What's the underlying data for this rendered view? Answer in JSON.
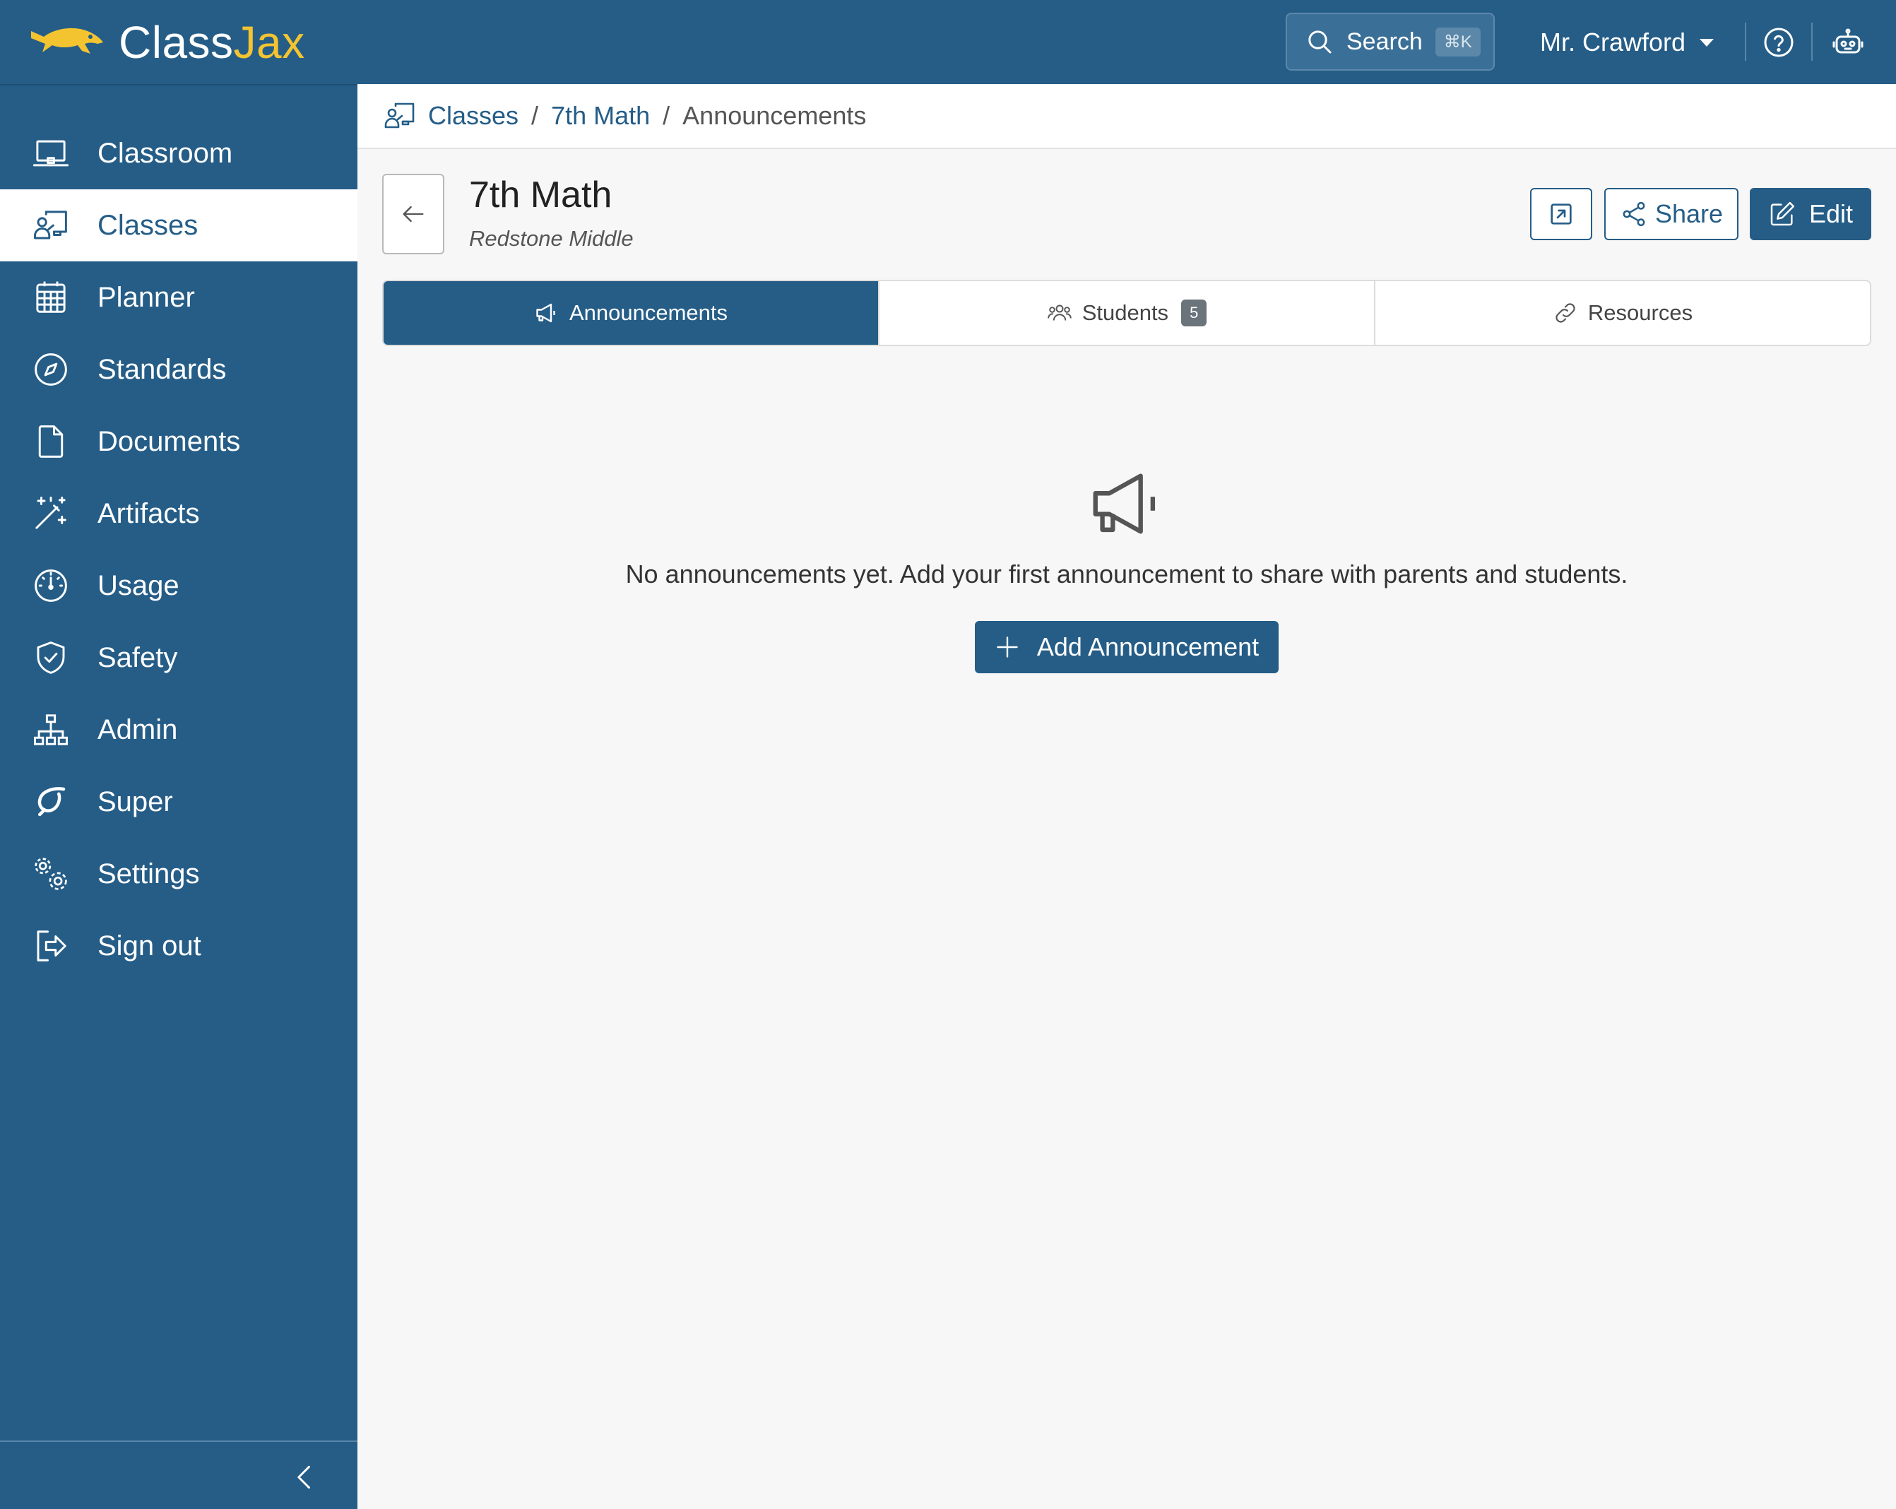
{
  "app": {
    "name_part1": "Class",
    "name_part2": "Jax",
    "brand_color": "#255d87",
    "accent_color": "#f4c430"
  },
  "topbar": {
    "search_label": "Search",
    "search_shortcut": "⌘K",
    "user_name": "Mr. Crawford",
    "icons": [
      "search-icon",
      "chevron-down-icon",
      "help-icon",
      "robot-icon"
    ]
  },
  "sidebar": {
    "items": [
      {
        "label": "Classroom",
        "icon": "laptop-icon"
      },
      {
        "label": "Classes",
        "icon": "teacher-board-icon",
        "active": true
      },
      {
        "label": "Planner",
        "icon": "calendar-grid-icon"
      },
      {
        "label": "Standards",
        "icon": "compass-icon"
      },
      {
        "label": "Documents",
        "icon": "document-icon"
      },
      {
        "label": "Artifacts",
        "icon": "magic-wand-icon"
      },
      {
        "label": "Usage",
        "icon": "clock-icon"
      },
      {
        "label": "Safety",
        "icon": "shield-check-icon"
      },
      {
        "label": "Admin",
        "icon": "org-chart-icon"
      },
      {
        "label": "Super",
        "icon": "swoosh-icon"
      },
      {
        "label": "Settings",
        "icon": "gears-icon"
      },
      {
        "label": "Sign out",
        "icon": "sign-out-icon"
      }
    ]
  },
  "breadcrumb": {
    "items": [
      "Classes",
      "7th Math"
    ],
    "current": "Announcements",
    "separator": "/"
  },
  "header": {
    "title": "7th Math",
    "subtitle": "Redstone Middle",
    "share_label": "Share",
    "edit_label": "Edit"
  },
  "tabs": [
    {
      "label": "Announcements",
      "icon": "megaphone-icon",
      "active": true
    },
    {
      "label": "Students",
      "icon": "people-icon",
      "badge": "5"
    },
    {
      "label": "Resources",
      "icon": "link-icon"
    }
  ],
  "empty_state": {
    "icon": "megaphone-icon",
    "message": "No announcements yet. Add your first announcement to share with parents and students.",
    "button_label": "Add Announcement"
  }
}
